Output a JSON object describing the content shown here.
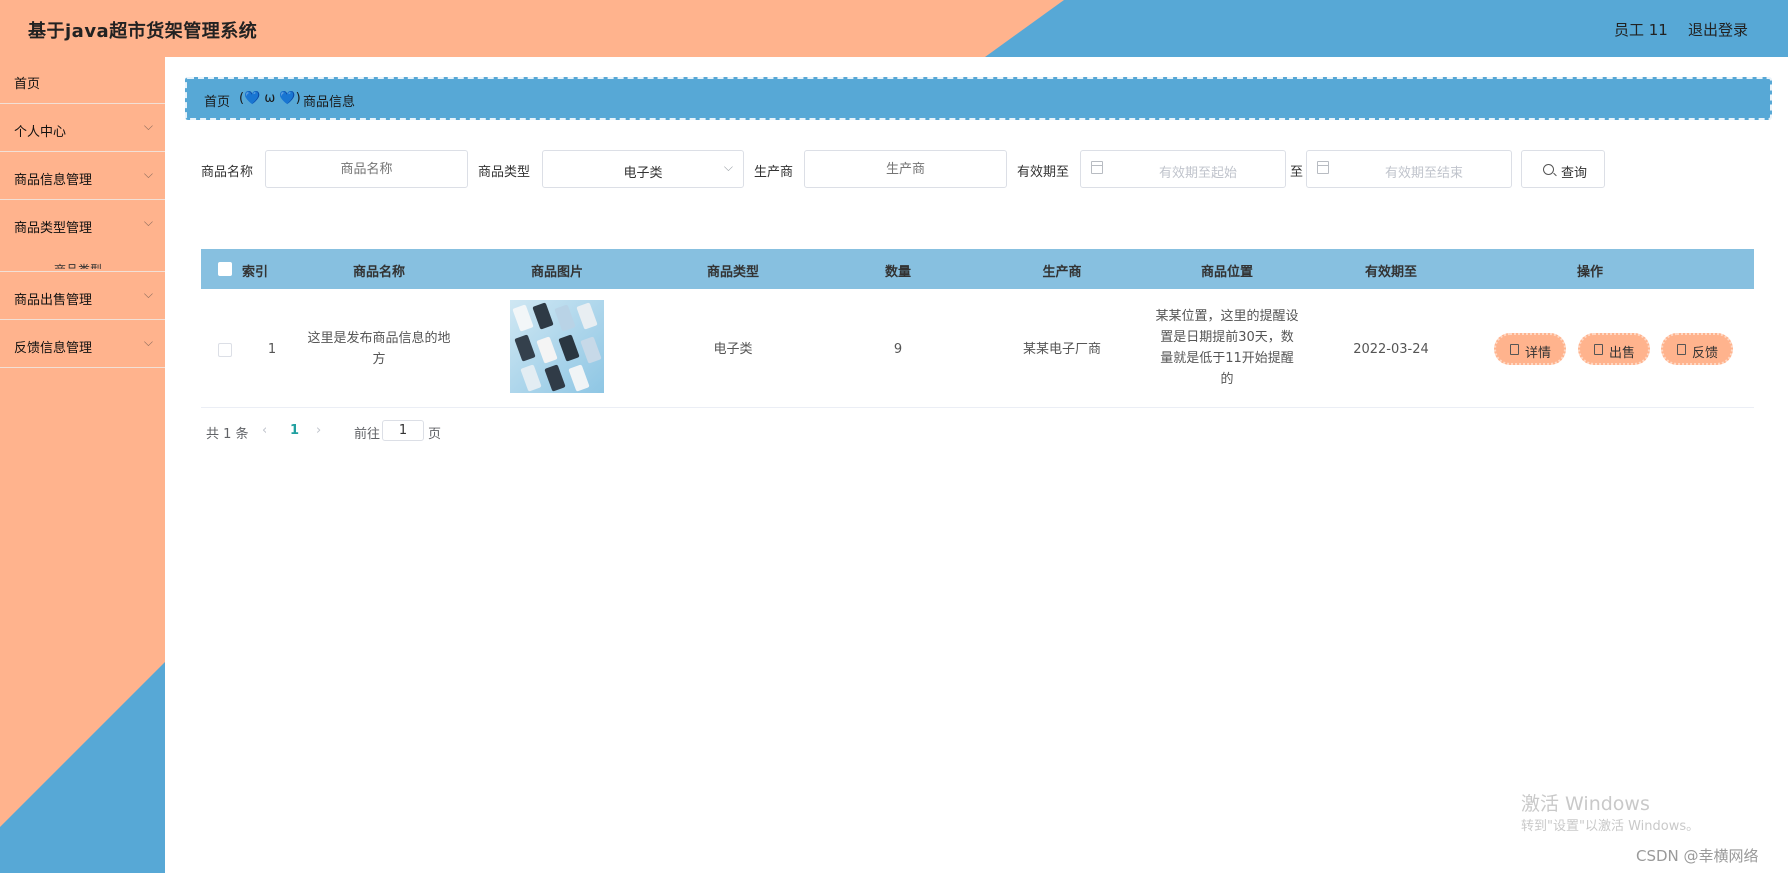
{
  "header": {
    "title": "基于java超市货架管理系统",
    "user": "员工 11",
    "logout": "退出登录"
  },
  "sidebar": {
    "items": [
      {
        "label": "首页"
      },
      {
        "label": "个人中心"
      },
      {
        "label": "商品信息管理"
      },
      {
        "label": "商品类型管理"
      },
      {
        "label": "商品出售管理"
      },
      {
        "label": "反馈信息管理"
      }
    ],
    "sub_peek": "商品类型"
  },
  "breadcrumb": {
    "home": "首页",
    "separator": "(💙 ω 💙)",
    "current": "商品信息"
  },
  "search": {
    "name_label": "商品名称",
    "name_placeholder": "商品名称",
    "type_label": "商品类型",
    "type_value": "电子类",
    "maker_label": "生产商",
    "maker_placeholder": "生产商",
    "expiry_label": "有效期至",
    "expiry_start_placeholder": "有效期至起始",
    "to_label": "至",
    "expiry_end_placeholder": "有效期至结束",
    "query_button": "查询"
  },
  "table": {
    "columns": [
      "索引",
      "商品名称",
      "商品图片",
      "商品类型",
      "数量",
      "生产商",
      "商品位置",
      "有效期至",
      "操作"
    ],
    "rows": [
      {
        "index": "1",
        "name_line1": "这里是发布商品信息的地",
        "name_line2": "方",
        "type": "电子类",
        "qty": "9",
        "maker": "某某电子厂商",
        "loc_line1": "某某位置，这里的提醒设",
        "loc_line2": "置是日期提前30天，数",
        "loc_line3": "量就是低于11开始提醒",
        "loc_line4": "的",
        "expiry": "2022-03-24",
        "actions": [
          "详情",
          "出售",
          "反馈"
        ]
      }
    ]
  },
  "pagination": {
    "total": "共 1 条",
    "prev": "‹",
    "current": "1",
    "next": "›",
    "goto": "前往",
    "page_value": "1",
    "page_unit": "页"
  },
  "watermark": {
    "line1": "激活 Windows",
    "line2": "转到\"设置\"以激活 Windows。",
    "csdn": "CSDN @幸横网络"
  },
  "colors": {
    "header_orange": "#ffb38d",
    "header_blue": "#57a8d6",
    "table_header": "#87c0e0"
  }
}
